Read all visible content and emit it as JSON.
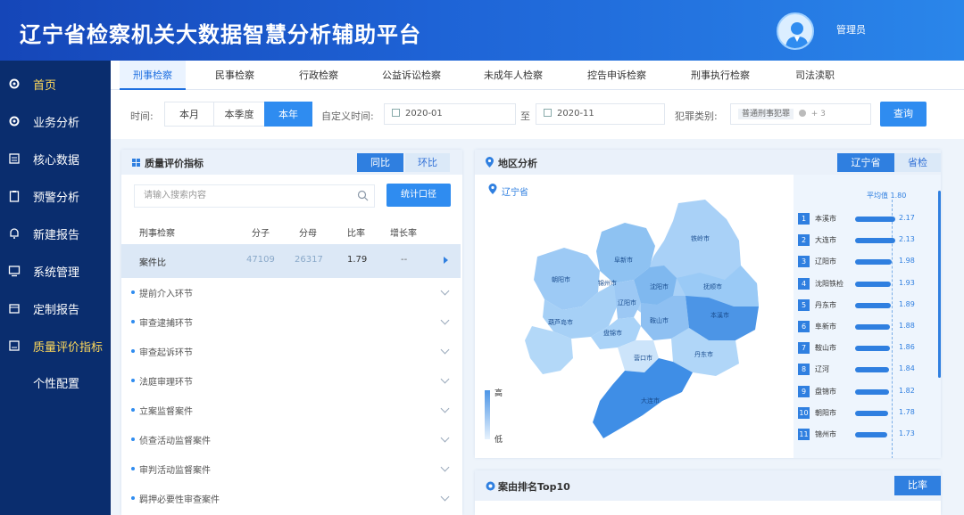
{
  "app": {
    "title": "辽宁省检察机关大数据智慧分析辅助平台",
    "user": "管理员"
  },
  "sidebar": {
    "items": [
      {
        "label": "首页",
        "icon": "gear-icon",
        "active": true
      },
      {
        "label": "业务分析",
        "icon": "gear-icon"
      },
      {
        "label": "核心数据",
        "icon": "document-icon"
      },
      {
        "label": "预警分析",
        "icon": "clipboard-icon"
      },
      {
        "label": "新建报告",
        "icon": "bell-icon"
      },
      {
        "label": "系统管理",
        "icon": "monitor-icon"
      },
      {
        "label": "定制报告",
        "icon": "calendar-icon"
      },
      {
        "label": "质量评价指标",
        "icon": "chart-icon",
        "highlight": true
      },
      {
        "label": "个性配置",
        "icon": ""
      }
    ]
  },
  "tabs": [
    "刑事检察",
    "民事检察",
    "行政检察",
    "公益诉讼检察",
    "未成年人检察",
    "控告申诉检察",
    "刑事执行检察",
    "司法渎职"
  ],
  "filters": {
    "time_label": "时间:",
    "time_options": [
      "本月",
      "本季度",
      "本年"
    ],
    "time_selected": "本年",
    "custom_label": "自定义时间:",
    "date_from": "2020-01",
    "to_label": "至",
    "date_to": "2020-11",
    "crime_label": "犯罪类别:",
    "crime_tag": "普通刑事犯罪",
    "crime_more": "+ 3",
    "query_button": "查询"
  },
  "quality_panel": {
    "title": "质量评价指标",
    "toggle": [
      "同比",
      "环比"
    ],
    "toggle_selected": "同比",
    "search_placeholder": "请输入搜索内容",
    "stat_button": "统计口径",
    "columns": [
      "刑事检察",
      "分子",
      "分母",
      "比率",
      "增长率"
    ],
    "row": {
      "name": "案件比",
      "numerator": "47109",
      "denominator": "26317",
      "ratio": "1.79",
      "growth": "--"
    },
    "sections": [
      "提前介入环节",
      "审查逮捕环节",
      "审查起诉环节",
      "法庭审理环节",
      "立案监督案件",
      "侦查活动监督案件",
      "审判活动监督案件",
      "羁押必要性审查案件"
    ]
  },
  "region_panel": {
    "title": "地区分析",
    "toggle": [
      "辽宁省",
      "省检"
    ],
    "toggle_selected": "辽宁省",
    "map_label": "辽宁省",
    "legend_high": "高",
    "legend_low": "低",
    "avg_label": "平均值  1.80",
    "avg_value": 1.8,
    "map_cities": [
      "铁岭市",
      "阜新市",
      "沈阳市",
      "抚顺市",
      "朝阳市",
      "锦州市",
      "辽阳市",
      "本溪市",
      "葫芦岛市",
      "盘锦市",
      "鞍山市",
      "营口市",
      "丹东市",
      "大连市"
    ],
    "ranking": [
      {
        "rank": "1",
        "name": "本溪市",
        "value": 2.17
      },
      {
        "rank": "2",
        "name": "大连市",
        "value": 2.13
      },
      {
        "rank": "3",
        "name": "辽阳市",
        "value": 1.98
      },
      {
        "rank": "4",
        "name": "沈阳铁检",
        "value": 1.93
      },
      {
        "rank": "5",
        "name": "丹东市",
        "value": 1.89
      },
      {
        "rank": "6",
        "name": "阜新市",
        "value": 1.88
      },
      {
        "rank": "7",
        "name": "鞍山市",
        "value": 1.86
      },
      {
        "rank": "8",
        "name": "辽河",
        "value": 1.84
      },
      {
        "rank": "9",
        "name": "盘锦市",
        "value": 1.82
      },
      {
        "rank": "10",
        "name": "朝阳市",
        "value": 1.78
      },
      {
        "rank": "11",
        "name": "锦州市",
        "value": 1.73
      }
    ],
    "colors": {
      "high": "#3f8ee6",
      "low": "#e5f1fd"
    }
  },
  "top10_panel": {
    "title": "案由排名Top10",
    "button": "比率"
  }
}
